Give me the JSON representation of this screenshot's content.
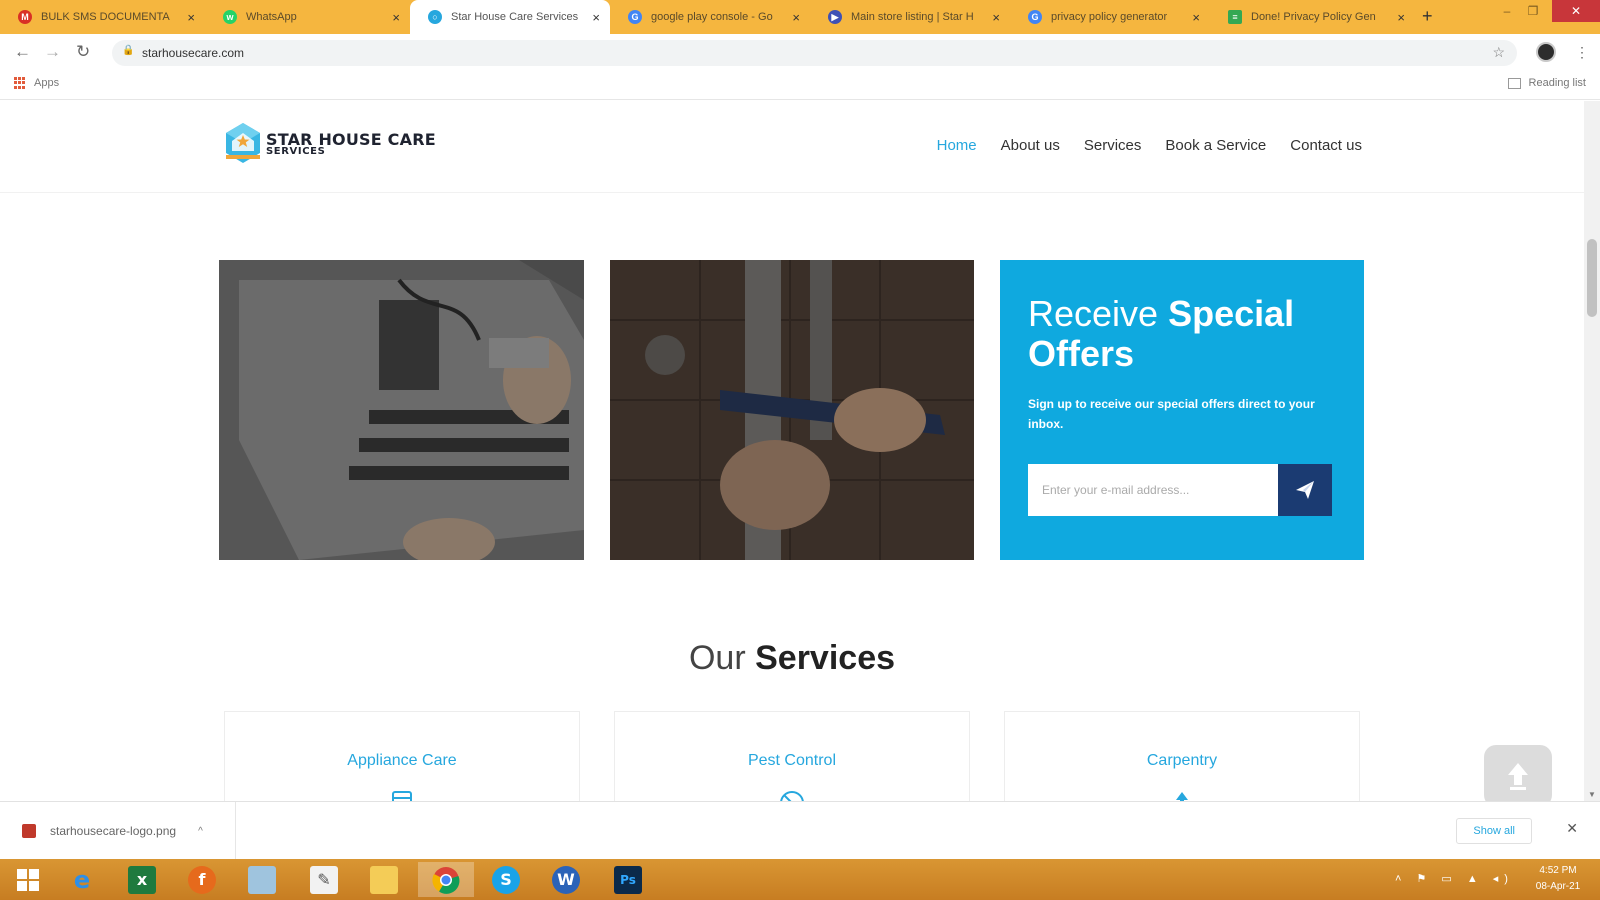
{
  "browser": {
    "tabs": [
      {
        "title": "BULK SMS DOCUMENTA",
        "favicon": "gmail-icon",
        "color": "#d93025"
      },
      {
        "title": "WhatsApp",
        "favicon": "whatsapp-icon",
        "color": "#25d366"
      },
      {
        "title": "Star House Care Services",
        "favicon": "site-icon",
        "color": "#26a7de"
      },
      {
        "title": "google play console - Go",
        "favicon": "google-icon",
        "color": "#4285f4"
      },
      {
        "title": "Main store listing | Star H",
        "favicon": "play-console-icon",
        "color": "#3f51b5"
      },
      {
        "title": "privacy policy generator",
        "favicon": "google-icon",
        "color": "#4285f4"
      },
      {
        "title": "Done! Privacy Policy Gen",
        "favicon": "doc-icon",
        "color": "#34a853"
      }
    ],
    "url": "starhousecare.com",
    "bookmarks": {
      "apps": "Apps",
      "reading_list": "Reading list"
    }
  },
  "site": {
    "logo": {
      "main": "STAR HOUSE CARE",
      "sub": "SERVICES"
    },
    "nav": [
      {
        "label": "Home",
        "active": true
      },
      {
        "label": "About us",
        "active": false
      },
      {
        "label": "Services",
        "active": false
      },
      {
        "label": "Book a Service",
        "active": false
      },
      {
        "label": "Contact us",
        "active": false
      }
    ],
    "offer": {
      "title_light": "Receive ",
      "title_bold": "Special Offers",
      "text": "Sign up to receive our special offers direct to your inbox.",
      "email_placeholder": "Enter your e-mail address..."
    },
    "services_heading": {
      "light": "Our ",
      "bold": "Services"
    },
    "services": [
      {
        "title": "Appliance Care",
        "icon": "appliance-icon"
      },
      {
        "title": "Pest Control",
        "icon": "pest-control-icon"
      },
      {
        "title": "Carpentry",
        "icon": "carpentry-icon"
      }
    ],
    "colors": {
      "accent": "#26a7de",
      "offer_bg": "#0fa9df",
      "button_dark": "#1b3b72"
    }
  },
  "downloads": {
    "file": "starhousecare-logo.png",
    "show_all": "Show all"
  },
  "taskbar": {
    "apps": [
      "windows-start-icon",
      "internet-explorer-icon",
      "excel-icon",
      "firefox-icon",
      "files-icon",
      "notepad-icon",
      "file-explorer-icon",
      "chrome-icon",
      "skype-icon",
      "word-icon",
      "photoshop-icon"
    ],
    "time": "4:52 PM",
    "date": "08-Apr-21"
  }
}
